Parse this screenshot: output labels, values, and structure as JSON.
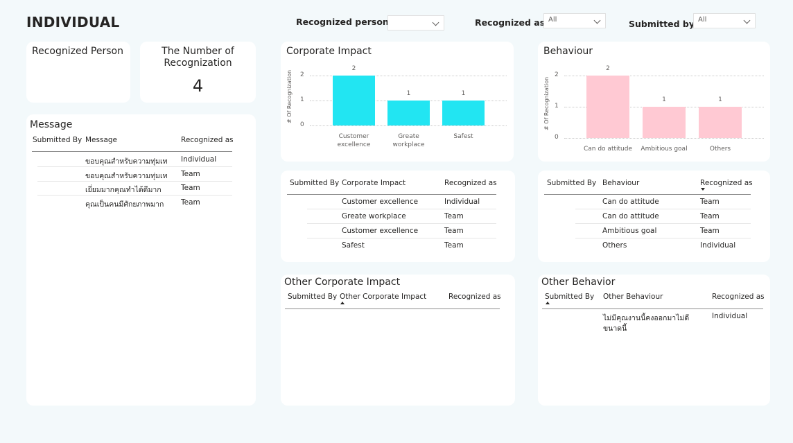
{
  "page_title": "INDIVIDUAL",
  "slicers": {
    "recognized_person": {
      "label": "Recognized person",
      "value": ""
    },
    "recognized_as": {
      "label": "Recognized as",
      "value": "All"
    },
    "submitted_by": {
      "label": "Submitted by",
      "value": "All"
    }
  },
  "cards": {
    "recognized_person": {
      "title": "Recognized Person"
    },
    "number": {
      "title_line1": "The Number of",
      "title_line2": "Recognization",
      "value": "4"
    }
  },
  "message_table": {
    "title": "Message",
    "headers": [
      "Submitted By",
      "Message",
      "Recognized as"
    ],
    "rows": [
      {
        "submitted_by": "",
        "message": "ขอบคุณสำหรับความทุ่มเท",
        "recognized_as": "Individual"
      },
      {
        "submitted_by": "",
        "message": "ขอบคุณสำหรับความทุ่มเท",
        "recognized_as": "Team"
      },
      {
        "submitted_by": "",
        "message": "เยี่ยมมากคุณทำได้ดีมาก",
        "recognized_as": "Team"
      },
      {
        "submitted_by": "",
        "message": "คุณเป็นคนมีศักยภาพมาก",
        "recognized_as": "Team"
      }
    ]
  },
  "corporate_table": {
    "headers": [
      "Submitted By",
      "Corporate Impact",
      "Recognized as"
    ],
    "rows": [
      {
        "submitted_by": "",
        "item": "Customer excellence",
        "recognized_as": "Individual"
      },
      {
        "submitted_by": "",
        "item": "Greate workplace",
        "recognized_as": "Team"
      },
      {
        "submitted_by": "",
        "item": "Customer excellence",
        "recognized_as": "Team"
      },
      {
        "submitted_by": "",
        "item": "Safest",
        "recognized_as": "Team"
      }
    ]
  },
  "behaviour_table": {
    "headers": [
      "Submitted By",
      "Behaviour",
      "Recognized as"
    ],
    "rows": [
      {
        "submitted_by": "",
        "item": "Can do attitude",
        "recognized_as": "Team"
      },
      {
        "submitted_by": "",
        "item": "Can do attitude",
        "recognized_as": "Team"
      },
      {
        "submitted_by": "",
        "item": "Ambitious goal",
        "recognized_as": "Team"
      },
      {
        "submitted_by": "",
        "item": "Others",
        "recognized_as": "Individual"
      }
    ]
  },
  "other_corporate_table": {
    "title": "Other Corporate Impact",
    "headers": [
      "Submitted By",
      "Other Corporate Impact",
      "Recognized as"
    ]
  },
  "other_behavior_table": {
    "title": "Other Behavior",
    "headers": [
      "Submitted By",
      "Other Behaviour",
      "Recognized as"
    ],
    "rows": [
      {
        "submitted_by": "",
        "item_line1": "ไม่มีคุณงานนี้คงออกมาไม่ดี",
        "item_line2": "ขนาดนี้",
        "recognized_as": "Individual"
      }
    ]
  },
  "chart_data": [
    {
      "type": "bar",
      "title": "Corporate Impact",
      "ylabel": "# Of Recognization",
      "xlabel": "",
      "categories": [
        "Customer excellence",
        "Greate workplace",
        "Safest"
      ],
      "values": [
        2,
        1,
        1
      ],
      "ylim": [
        0,
        2
      ],
      "yticks": [
        "0",
        "1",
        "2"
      ],
      "color": "#22e5f2",
      "grid": true
    },
    {
      "type": "bar",
      "title": "Behaviour",
      "ylabel": "# Of Recognization",
      "xlabel": "",
      "categories": [
        "Can do attitude",
        "Ambitious goal",
        "Others"
      ],
      "values": [
        2,
        1,
        1
      ],
      "ylim": [
        0,
        2
      ],
      "yticks": [
        "0",
        "1",
        "2"
      ],
      "color": "#ffc9d3",
      "grid": true
    }
  ]
}
